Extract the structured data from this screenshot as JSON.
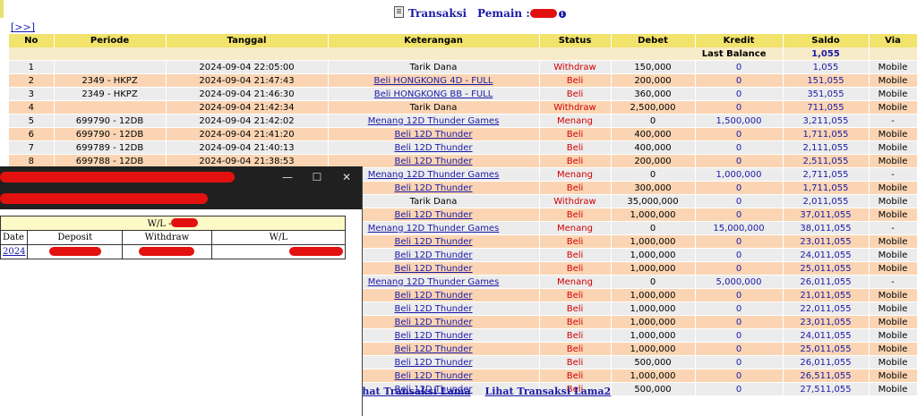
{
  "page": {
    "title_transaksi": "Transaksi",
    "title_pemain": "Pemain :",
    "expand_link": "[>>]"
  },
  "columns": [
    "No",
    "Periode",
    "Tanggal",
    "Keterangan",
    "Status",
    "Debet",
    "Kredit",
    "Saldo",
    "Via"
  ],
  "last_balance": {
    "label": "Last Balance",
    "value": "1,055"
  },
  "rows": [
    {
      "no": "1",
      "periode": "",
      "tanggal": "2024-09-04 22:05:00",
      "ket": "Tarik Dana",
      "status": "Withdraw",
      "debet": "150,000",
      "kredit": "0",
      "saldo": "1,055",
      "via": "Mobile",
      "link": false
    },
    {
      "no": "2",
      "periode": "2349 - HKPZ",
      "tanggal": "2024-09-04 21:47:43",
      "ket": "Beli HONGKONG 4D - FULL",
      "status": "Beli",
      "debet": "200,000",
      "kredit": "0",
      "saldo": "151,055",
      "via": "Mobile",
      "link": true
    },
    {
      "no": "3",
      "periode": "2349 - HKPZ",
      "tanggal": "2024-09-04 21:46:30",
      "ket": "Beli HONGKONG BB - FULL",
      "status": "Beli",
      "debet": "360,000",
      "kredit": "0",
      "saldo": "351,055",
      "via": "Mobile",
      "link": true
    },
    {
      "no": "4",
      "periode": "",
      "tanggal": "2024-09-04 21:42:34",
      "ket": "Tarik Dana",
      "status": "Withdraw",
      "debet": "2,500,000",
      "kredit": "0",
      "saldo": "711,055",
      "via": "Mobile",
      "link": false
    },
    {
      "no": "5",
      "periode": "699790 - 12DB",
      "tanggal": "2024-09-04 21:42:02",
      "ket": "Menang 12D Thunder Games",
      "status": "Menang",
      "debet": "0",
      "kredit": "1,500,000",
      "saldo": "3,211,055",
      "via": "-",
      "link": true
    },
    {
      "no": "6",
      "periode": "699790 - 12DB",
      "tanggal": "2024-09-04 21:41:20",
      "ket": "Beli 12D Thunder",
      "status": "Beli",
      "debet": "400,000",
      "kredit": "0",
      "saldo": "1,711,055",
      "via": "Mobile",
      "link": true
    },
    {
      "no": "7",
      "periode": "699789 - 12DB",
      "tanggal": "2024-09-04 21:40:13",
      "ket": "Beli 12D Thunder",
      "status": "Beli",
      "debet": "400,000",
      "kredit": "0",
      "saldo": "2,111,055",
      "via": "Mobile",
      "link": true
    },
    {
      "no": "8",
      "periode": "699788 - 12DB",
      "tanggal": "2024-09-04 21:38:53",
      "ket": "Beli 12D Thunder",
      "status": "Beli",
      "debet": "200,000",
      "kredit": "0",
      "saldo": "2,511,055",
      "via": "Mobile",
      "link": true
    },
    {
      "no": "",
      "periode": "",
      "tanggal": "",
      "ket": "Menang 12D Thunder Games",
      "status": "Menang",
      "debet": "0",
      "kredit": "1,000,000",
      "saldo": "2,711,055",
      "via": "-",
      "link": true
    },
    {
      "no": "",
      "periode": "",
      "tanggal": "",
      "ket": "Beli 12D Thunder",
      "status": "Beli",
      "debet": "300,000",
      "kredit": "0",
      "saldo": "1,711,055",
      "via": "Mobile",
      "link": true
    },
    {
      "no": "",
      "periode": "",
      "tanggal": "",
      "ket": "Tarik Dana",
      "status": "Withdraw",
      "debet": "35,000,000",
      "kredit": "0",
      "saldo": "2,011,055",
      "via": "Mobile",
      "link": false
    },
    {
      "no": "",
      "periode": "",
      "tanggal": "",
      "ket": "Beli 12D Thunder",
      "status": "Beli",
      "debet": "1,000,000",
      "kredit": "0",
      "saldo": "37,011,055",
      "via": "Mobile",
      "link": true
    },
    {
      "no": "",
      "periode": "",
      "tanggal": "",
      "ket": "Menang 12D Thunder Games",
      "status": "Menang",
      "debet": "0",
      "kredit": "15,000,000",
      "saldo": "38,011,055",
      "via": "-",
      "link": true
    },
    {
      "no": "",
      "periode": "",
      "tanggal": "",
      "ket": "Beli 12D Thunder",
      "status": "Beli",
      "debet": "1,000,000",
      "kredit": "0",
      "saldo": "23,011,055",
      "via": "Mobile",
      "link": true
    },
    {
      "no": "",
      "periode": "",
      "tanggal": "",
      "ket": "Beli 12D Thunder",
      "status": "Beli",
      "debet": "1,000,000",
      "kredit": "0",
      "saldo": "24,011,055",
      "via": "Mobile",
      "link": true
    },
    {
      "no": "",
      "periode": "",
      "tanggal": "",
      "ket": "Beli 12D Thunder",
      "status": "Beli",
      "debet": "1,000,000",
      "kredit": "0",
      "saldo": "25,011,055",
      "via": "Mobile",
      "link": true
    },
    {
      "no": "",
      "periode": "",
      "tanggal": "",
      "ket": "Menang 12D Thunder Games",
      "status": "Menang",
      "debet": "0",
      "kredit": "5,000,000",
      "saldo": "26,011,055",
      "via": "-",
      "link": true
    },
    {
      "no": "",
      "periode": "",
      "tanggal": "",
      "ket": "Beli 12D Thunder",
      "status": "Beli",
      "debet": "1,000,000",
      "kredit": "0",
      "saldo": "21,011,055",
      "via": "Mobile",
      "link": true
    },
    {
      "no": "",
      "periode": "",
      "tanggal": "",
      "ket": "Beli 12D Thunder",
      "status": "Beli",
      "debet": "1,000,000",
      "kredit": "0",
      "saldo": "22,011,055",
      "via": "Mobile",
      "link": true
    },
    {
      "no": "",
      "periode": "",
      "tanggal": "",
      "ket": "Beli 12D Thunder",
      "status": "Beli",
      "debet": "1,000,000",
      "kredit": "0",
      "saldo": "23,011,055",
      "via": "Mobile",
      "link": true
    },
    {
      "no": "",
      "periode": "",
      "tanggal": "",
      "ket": "Beli 12D Thunder",
      "status": "Beli",
      "debet": "1,000,000",
      "kredit": "0",
      "saldo": "24,011,055",
      "via": "Mobile",
      "link": true
    },
    {
      "no": "",
      "periode": "",
      "tanggal": "",
      "ket": "Beli 12D Thunder",
      "status": "Beli",
      "debet": "1,000,000",
      "kredit": "0",
      "saldo": "25,011,055",
      "via": "Mobile",
      "link": true
    },
    {
      "no": "",
      "periode": "",
      "tanggal": "",
      "ket": "Beli 12D Thunder",
      "status": "Beli",
      "debet": "500,000",
      "kredit": "0",
      "saldo": "26,011,055",
      "via": "Mobile",
      "link": true
    },
    {
      "no": "",
      "periode": "",
      "tanggal": "",
      "ket": "Beli 12D Thunder",
      "status": "Beli",
      "debet": "1,000,000",
      "kredit": "0",
      "saldo": "26,511,055",
      "via": "Mobile",
      "link": true
    },
    {
      "no": "",
      "periode": "",
      "tanggal": "",
      "ket": "Beli 12D Thunder",
      "status": "Beli",
      "debet": "500,000",
      "kredit": "0",
      "saldo": "27,511,055",
      "via": "Mobile",
      "link": true
    }
  ],
  "footer": {
    "link1": "lihat Transaksi Lama",
    "link2": "Lihat Transaksi Lama2"
  },
  "popup": {
    "window_buttons": [
      "—",
      "☐",
      "✕"
    ],
    "wl_title": "W/L -",
    "headers": [
      "Date",
      "Deposit",
      "Withdraw",
      "W/L"
    ],
    "row_date": "2024"
  },
  "colors": {
    "header_bg": "#f1e36b",
    "row_odd": "#ececec",
    "row_even": "#fbd5b3",
    "link": "#1a1aa8",
    "status_red": "#d00000",
    "redaction": "#e31010"
  }
}
